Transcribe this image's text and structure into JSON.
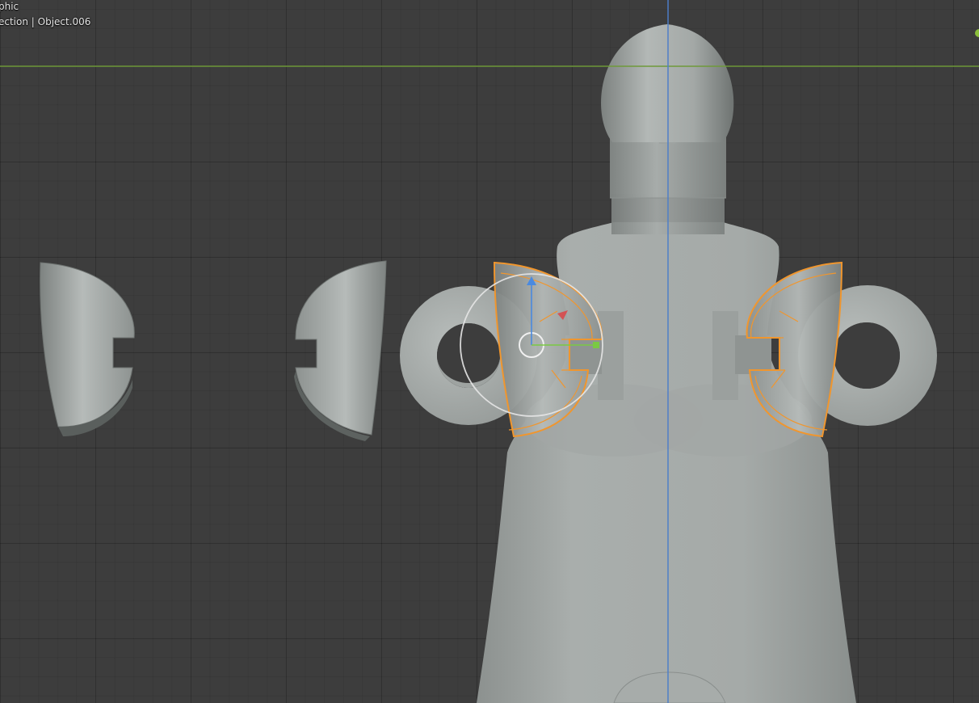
{
  "viewport": {
    "view_mode_label": "phic",
    "collection_label": "ection | Object.006"
  },
  "colors": {
    "background": "#3d3d3d",
    "x_axis_line": "#6f9a3a",
    "z_axis_line": "#4f7fc8",
    "selection_outline": "#f0962e",
    "mesh_gray": "#9ea3a1",
    "gizmo_x": "#d8494b",
    "gizmo_y": "#7ac943",
    "gizmo_z": "#4a8ae0",
    "nav_dot": "#8bbf3c"
  },
  "scene": {
    "objects": [
      "Object.006"
    ],
    "active_object": "Object.006",
    "icons": [
      "transform-gizmo-icon",
      "axis-dot-icon"
    ]
  }
}
